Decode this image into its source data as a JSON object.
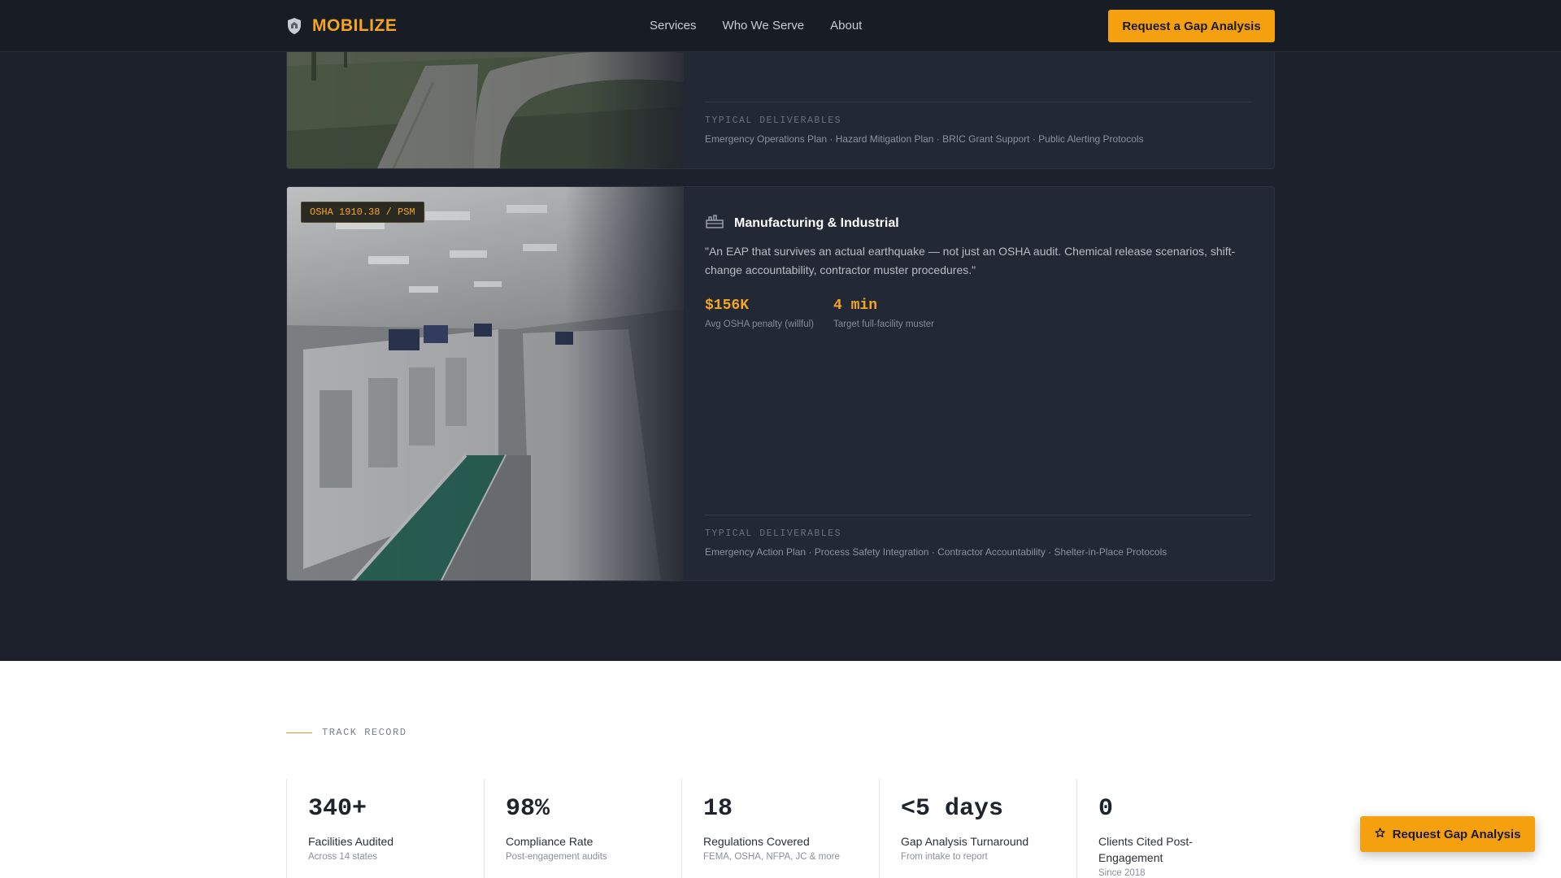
{
  "header": {
    "brand": "MOBILIZE",
    "nav": [
      "Services",
      "Who We Serve",
      "About"
    ],
    "cta": "Request a Gap Analysis"
  },
  "card_government": {
    "deliverables_label": "TYPICAL DELIVERABLES",
    "deliverables": "Emergency Operations Plan · Hazard Mitigation Plan · BRIC Grant Support · Public Alerting Protocols"
  },
  "card_manufacturing": {
    "badge": "OSHA 1910.38 / PSM",
    "title": "Manufacturing & Industrial",
    "quote": "\"An EAP that survives an actual earthquake — not just an OSHA audit. Chemical release scenarios, shift-change accountability, contractor muster procedures.\"",
    "metrics": [
      {
        "value": "$156K",
        "label": "Avg OSHA penalty (willful)"
      },
      {
        "value": "4 min",
        "label": "Target full-facility muster"
      }
    ],
    "deliverables_label": "TYPICAL DELIVERABLES",
    "deliverables": "Emergency Action Plan · Process Safety Integration · Contractor Accountability · Shelter-in-Place Protocols"
  },
  "track_record": {
    "label": "TRACK RECORD",
    "stats": [
      {
        "value": "340+",
        "label": "Facilities Audited",
        "sub": "Across 14 states"
      },
      {
        "value": "98%",
        "label": "Compliance Rate",
        "sub": "Post-engagement audits"
      },
      {
        "value": "18",
        "label": "Regulations Covered",
        "sub": "FEMA, OSHA, NFPA, JC & more"
      },
      {
        "value": "<5 days",
        "label": "Gap Analysis Turnaround",
        "sub": "From intake to report"
      },
      {
        "value": "0",
        "label": "Clients Cited Post-Engagement",
        "sub": "Since 2018"
      }
    ]
  },
  "floating_cta": {
    "label": "Request Gap Analysis",
    "icon": "star-icon"
  },
  "colors": {
    "accent": "#f5a00f",
    "background": "#1c212b",
    "card": "#232934"
  }
}
